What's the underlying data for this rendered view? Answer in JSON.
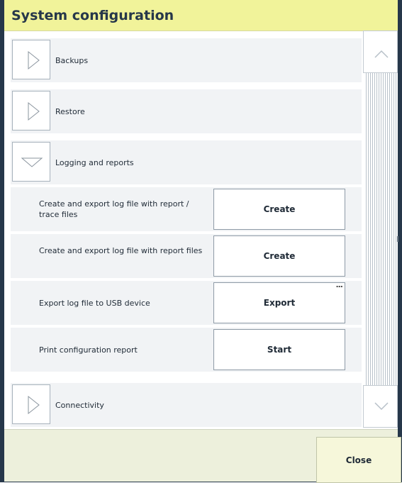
{
  "window": {
    "title": "System configuration"
  },
  "sections": [
    {
      "label": "Backups",
      "expanded": false,
      "icon": "chevron-right-icon"
    },
    {
      "label": "Restore",
      "expanded": false,
      "icon": "chevron-right-icon"
    },
    {
      "label": "Logging and reports",
      "expanded": true,
      "icon": "chevron-down-icon"
    },
    {
      "label": "Connectivity",
      "expanded": false,
      "icon": "chevron-right-icon"
    }
  ],
  "logging_items": [
    {
      "label": "Create and export log file with report / trace files",
      "button": "Create"
    },
    {
      "label": "Create and export log file with report files",
      "button": "Create"
    },
    {
      "label": "Export log file to USB device",
      "button": "Export",
      "more_indicator": "..."
    },
    {
      "label": "Print configuration report",
      "button": "Start"
    }
  ],
  "scrollbar": {
    "up_icon": "scroll-up-icon",
    "down_icon": "scroll-down-icon"
  },
  "footer": {
    "close_label": "Close"
  },
  "colors": {
    "title_bar": "#f1f39a",
    "frame": "#26374a",
    "row_background": "#f1f3f5",
    "footer": "#edf0dc"
  }
}
